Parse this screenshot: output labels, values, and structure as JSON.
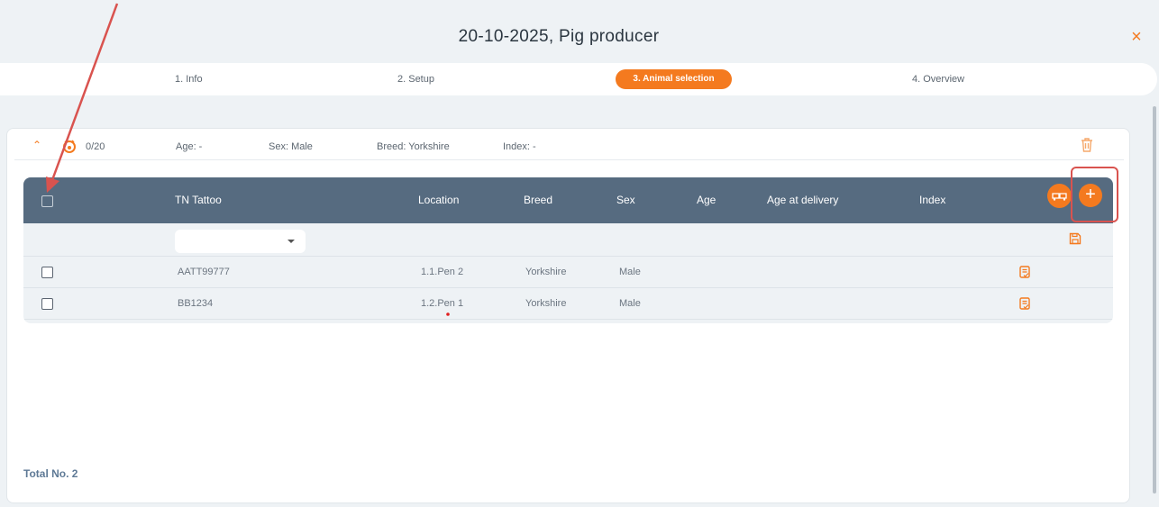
{
  "header": {
    "title": "20-10-2025, Pig producer",
    "close_label": "×"
  },
  "steps": [
    {
      "label": "1. Info"
    },
    {
      "label": "2. Setup"
    },
    {
      "label": "3. Animal selection",
      "active": true
    },
    {
      "label": "4. Overview"
    }
  ],
  "group": {
    "count": "0/20",
    "age": "Age: -",
    "sex": "Sex: Male",
    "breed": "Breed: Yorkshire",
    "index": "Index: -"
  },
  "table": {
    "columns": [
      "TN Tattoo",
      "Location",
      "Breed",
      "Sex",
      "Age",
      "Age at delivery",
      "Index"
    ],
    "filter": {
      "tn_tattoo_value": ""
    },
    "rows": [
      {
        "tattoo": "AATT99777",
        "location": "1.1.Pen 2",
        "breed": "Yorkshire",
        "sex": "Male",
        "age": "",
        "age_at_delivery": "",
        "index": ""
      },
      {
        "tattoo": "BB1234",
        "location": "1.2.Pen 1",
        "breed": "Yorkshire",
        "sex": "Male",
        "age": "",
        "age_at_delivery": "",
        "index": ""
      }
    ],
    "add_button_label": "+"
  },
  "footer": {
    "total": "Total No. 2"
  },
  "colors": {
    "accent": "#f47a1f",
    "table_header": "#566b80",
    "annotation_red": "#d9534f"
  },
  "icons": [
    "close-icon",
    "chevron-up-icon",
    "pig-icon",
    "trash-icon",
    "transport-icon",
    "add-icon",
    "save-icon",
    "note-check-icon",
    "chevron-down-icon"
  ]
}
